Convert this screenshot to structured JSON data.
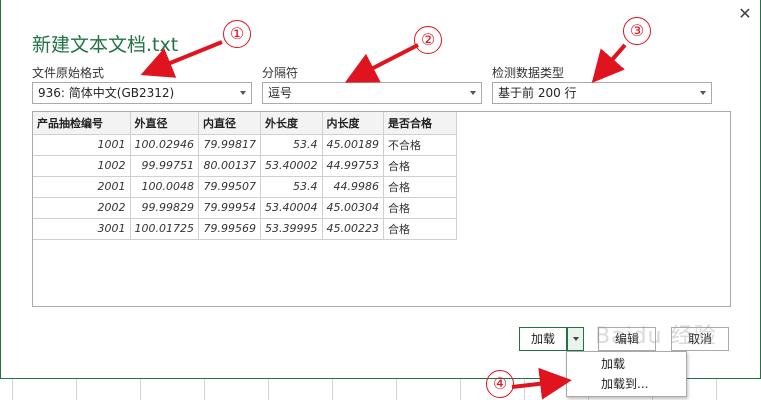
{
  "dialog": {
    "title": "新建文本文档.txt",
    "close_glyph": "✕"
  },
  "fields": {
    "file_origin": {
      "label": "文件原始格式",
      "value": "936: 简体中文(GB2312)"
    },
    "delimiter": {
      "label": "分隔符",
      "value": "逗号"
    },
    "data_type_detection": {
      "label": "检测数据类型",
      "value": "基于前 200 行"
    }
  },
  "table": {
    "headers": [
      "产品抽检编号",
      "外直径",
      "内直径",
      "外长度",
      "内长度",
      "是否合格"
    ],
    "rows": [
      [
        "1001",
        "100.02946",
        "79.99817",
        "53.4",
        "45.00189",
        "不合格"
      ],
      [
        "1002",
        "99.99751",
        "80.00137",
        "53.40002",
        "44.99753",
        "合格"
      ],
      [
        "2001",
        "100.0048",
        "79.99507",
        "53.4",
        "44.9986",
        "合格"
      ],
      [
        "2002",
        "99.99829",
        "79.99954",
        "53.40004",
        "45.00304",
        "合格"
      ],
      [
        "3001",
        "100.01725",
        "79.99569",
        "53.39995",
        "45.00223",
        "合格"
      ]
    ]
  },
  "buttons": {
    "load": "加载",
    "edit": "编辑",
    "cancel": "取消"
  },
  "load_menu": {
    "items": [
      "加载",
      "加载到..."
    ]
  },
  "annotations": [
    "①",
    "②",
    "③",
    "④"
  ],
  "watermark": "Baidu 经验",
  "colors": {
    "accent": "#217346",
    "annotation_red": "#e0141e"
  }
}
